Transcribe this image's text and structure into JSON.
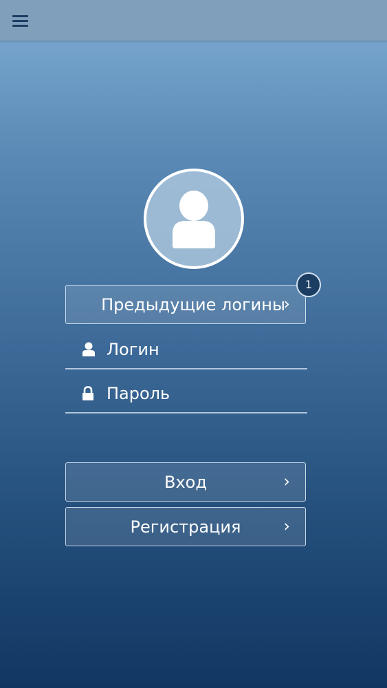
{
  "topbar": {
    "menu_icon": "hamburger-menu-icon"
  },
  "avatar": {
    "icon": "user-silhouette-icon"
  },
  "previous_logins": {
    "label": "Предыдущие логины",
    "chevron": "›",
    "badge_count": "1"
  },
  "form": {
    "login": {
      "placeholder": "Логин",
      "icon": "user-icon"
    },
    "password": {
      "placeholder": "Пароль",
      "icon": "lock-icon"
    }
  },
  "actions": {
    "login_label": "Вход",
    "register_label": "Регистрация",
    "chevron": "›"
  },
  "colors": {
    "topbar": "#7f9fba",
    "menu_icon": "#1c3e63",
    "gradient_top": "#7fadd4",
    "gradient_bottom": "#123662",
    "badge_bg": "#1c3e63",
    "text": "#ffffff"
  }
}
